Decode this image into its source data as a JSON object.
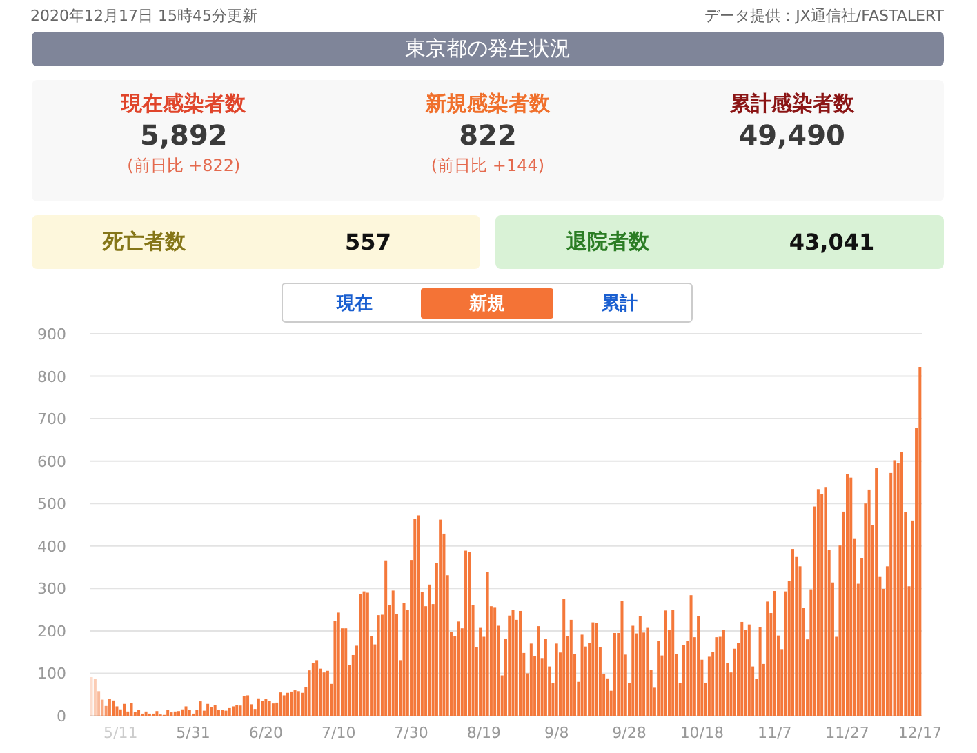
{
  "header": {
    "updated": "2020年12月17日 15時45分更新",
    "source": "データ提供：JX通信社/FASTALERT"
  },
  "title": "東京都の発生状況",
  "stats": [
    {
      "kind": "current",
      "label": "現在感染者数",
      "value": "5,892",
      "change": "(前日比 +822)"
    },
    {
      "kind": "new",
      "label": "新規感染者数",
      "value": "822",
      "change": "(前日比 +144)"
    },
    {
      "kind": "total",
      "label": "累計感染者数",
      "value": "49,490"
    }
  ],
  "outcomes": [
    {
      "kind": "deaths",
      "label": "死亡者数",
      "value": "557"
    },
    {
      "kind": "recovered",
      "label": "退院者数",
      "value": "43,041"
    }
  ],
  "tabs": [
    {
      "label": "現在",
      "selected": false
    },
    {
      "label": "新規",
      "selected": true
    },
    {
      "label": "累計",
      "selected": false
    }
  ],
  "chart": {
    "chart_data": {
      "type": "bar",
      "grid": true,
      "categories": [
        null,
        null,
        null,
        null,
        null,
        null,
        null,
        null,
        "5/11",
        null,
        null,
        null,
        null,
        null,
        null,
        null,
        null,
        null,
        null,
        null,
        null,
        null,
        null,
        null,
        null,
        null,
        null,
        null,
        "5/31",
        null,
        null,
        null,
        null,
        null,
        null,
        null,
        null,
        null,
        null,
        null,
        null,
        null,
        null,
        null,
        null,
        null,
        null,
        null,
        "6/20",
        null,
        null,
        null,
        null,
        null,
        null,
        null,
        null,
        null,
        null,
        null,
        null,
        null,
        null,
        null,
        null,
        null,
        null,
        null,
        "7/10",
        null,
        null,
        null,
        null,
        null,
        null,
        null,
        null,
        null,
        null,
        null,
        null,
        null,
        null,
        null,
        null,
        null,
        null,
        null,
        "7/30",
        null,
        null,
        null,
        null,
        null,
        null,
        null,
        null,
        null,
        null,
        null,
        null,
        null,
        null,
        null,
        null,
        null,
        null,
        null,
        "8/19",
        null,
        null,
        null,
        null,
        null,
        null,
        null,
        null,
        null,
        null,
        null,
        null,
        null,
        null,
        null,
        null,
        null,
        null,
        null,
        "9/8",
        null,
        null,
        null,
        null,
        null,
        null,
        null,
        null,
        null,
        null,
        null,
        null,
        null,
        null,
        null,
        null,
        null,
        null,
        null,
        "9/28",
        null,
        null,
        null,
        null,
        null,
        null,
        null,
        null,
        null,
        null,
        null,
        null,
        null,
        null,
        null,
        null,
        null,
        null,
        null,
        "10/18",
        null,
        null,
        null,
        null,
        null,
        null,
        null,
        null,
        null,
        null,
        null,
        null,
        null,
        null,
        null,
        null,
        null,
        null,
        null,
        "11/7",
        null,
        null,
        null,
        null,
        null,
        null,
        null,
        null,
        null,
        null,
        null,
        null,
        null,
        null,
        null,
        null,
        null,
        null,
        null,
        "11/27",
        null,
        null,
        null,
        null,
        null,
        null,
        null,
        null,
        null,
        null,
        null,
        null,
        null,
        null,
        null,
        null,
        null,
        null,
        null,
        "12/17"
      ],
      "series": [
        {
          "color": "#f4783a",
          "values": [
            91,
            87,
            58,
            38,
            23,
            39,
            36,
            22,
            15,
            28,
            10,
            30,
            9,
            14,
            5,
            10,
            5,
            5,
            11,
            3,
            2,
            14,
            8,
            10,
            11,
            15,
            22,
            14,
            5,
            13,
            34,
            12,
            28,
            20,
            26,
            14,
            13,
            12,
            18,
            22,
            25,
            24,
            47,
            48,
            27,
            16,
            41,
            35,
            39,
            35,
            29,
            31,
            55,
            48,
            54,
            57,
            60,
            58,
            54,
            67,
            107,
            124,
            131,
            111,
            102,
            106,
            75,
            224,
            243,
            206,
            206,
            119,
            143,
            165,
            286,
            293,
            290,
            188,
            168,
            237,
            238,
            366,
            260,
            295,
            239,
            131,
            266,
            250,
            367,
            463,
            472,
            292,
            258,
            309,
            263,
            360,
            462,
            429,
            331,
            197,
            188,
            222,
            206,
            389,
            385,
            260,
            161,
            207,
            186,
            339,
            258,
            256,
            212,
            95,
            182,
            236,
            250,
            226,
            247,
            148,
            100,
            170,
            141,
            211,
            136,
            181,
            116,
            77,
            170,
            149,
            276,
            187,
            226,
            146,
            80,
            191,
            163,
            171,
            220,
            218,
            162,
            98,
            88,
            59,
            195,
            195,
            270,
            144,
            78,
            212,
            194,
            235,
            196,
            207,
            108,
            66,
            177,
            142,
            248,
            203,
            249,
            146,
            78,
            166,
            177,
            284,
            185,
            235,
            132,
            78,
            139,
            150,
            185,
            186,
            203,
            124,
            102,
            158,
            171,
            221,
            203,
            215,
            116,
            87,
            209,
            122,
            269,
            242,
            294,
            189,
            157,
            293,
            317,
            393,
            374,
            352,
            255,
            180,
            298,
            493,
            534,
            522,
            539,
            391,
            314,
            186,
            401,
            481,
            570,
            561,
            418,
            311,
            372,
            500,
            533,
            449,
            584,
            327,
            299,
            352,
            572,
            602,
            595,
            621,
            480,
            305,
            460,
            678,
            822
          ]
        }
      ],
      "ylim": [
        0,
        900
      ],
      "yticks": [
        0,
        100,
        200,
        300,
        400,
        500,
        600,
        700,
        800,
        900
      ]
    }
  }
}
